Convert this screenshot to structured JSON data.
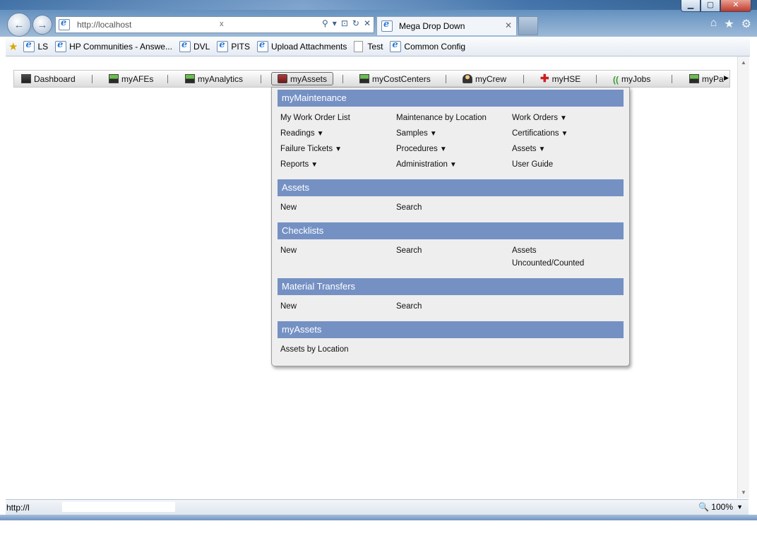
{
  "browser": {
    "address_url": "http://localhost",
    "address_suffix": "x",
    "tab_title": "Mega Drop Down",
    "status_url": "http://l",
    "zoom": "100%"
  },
  "favorites": [
    {
      "label": "LS",
      "icon": "ie"
    },
    {
      "label": "HP Communities - Answe...",
      "icon": "ie"
    },
    {
      "label": "DVL",
      "icon": "ie"
    },
    {
      "label": "PITS",
      "icon": "ie"
    },
    {
      "label": "Upload Attachments",
      "icon": "ie"
    },
    {
      "label": "Test",
      "icon": "page"
    },
    {
      "label": "Common Config",
      "icon": "ie"
    }
  ],
  "menubar": {
    "items": [
      {
        "label": "Dashboard",
        "icon": "dashboard-icon"
      },
      {
        "label": "myAFEs",
        "icon": "afes-icon"
      },
      {
        "label": "myAnalytics",
        "icon": "analytics-icon"
      },
      {
        "label": "myAssets",
        "icon": "assets-icon",
        "active": true
      },
      {
        "label": "myCostCenters",
        "icon": "costcenters-icon"
      },
      {
        "label": "myCrew",
        "icon": "crew-icon"
      },
      {
        "label": "myHSE",
        "icon": "hse-cross-icon"
      },
      {
        "label": "myJobs",
        "icon": "jobs-icon"
      },
      {
        "label": "myPa",
        "icon": "pa-icon"
      }
    ]
  },
  "dropdown": {
    "sections": [
      {
        "title": "myMaintenance",
        "links": [
          "My Work Order List",
          "Maintenance by Location",
          "Work Orders",
          "Readings",
          "Samples",
          "Certifications",
          "Failure Tickets",
          "Procedures",
          "Assets",
          "Reports",
          "Administration",
          "User Guide"
        ],
        "arrow": "▼"
      },
      {
        "title": "Assets",
        "links": [
          "New",
          "Search"
        ]
      },
      {
        "title": "Checklists",
        "links": [
          "New",
          "Search",
          "Assets",
          "Uncounted/Counted"
        ]
      },
      {
        "title": "Material Transfers",
        "links": [
          "New",
          "Search"
        ]
      },
      {
        "title": "myAssets",
        "links": [
          "Assets by Location"
        ]
      }
    ]
  }
}
